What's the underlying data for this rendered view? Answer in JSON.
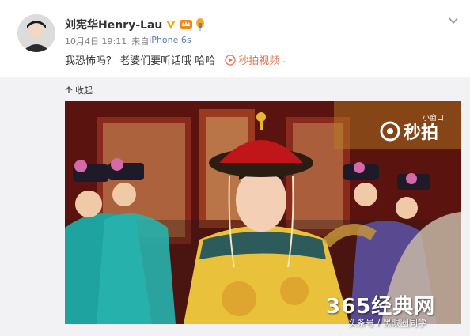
{
  "post": {
    "username": "刘宪华Henry-Lau",
    "time": "10月4日 19:11",
    "source_prefix": "来自",
    "device": "iPhone 6s",
    "text": "我恐怖吗？ 老婆们要听话哦 哈哈",
    "video_link": "秒拍视频",
    "trailing": "."
  },
  "actions": {
    "collapse": "收起"
  },
  "video": {
    "brand": "秒拍",
    "mini_window": "小窗口",
    "watermark_site": "365经典网",
    "watermark_wechat": "头条号 / 黑眼圈同学"
  },
  "colors": {
    "link": "#eb7350",
    "username": "#333333",
    "meta": "#808080",
    "verified": "#f7ab00",
    "panel": "#f2f2f5"
  },
  "icons": {
    "verified": "verified-badge-icon",
    "vip": "vip-crown-icon",
    "balloon": "balloon-icon",
    "chevron": "chevron-down-icon",
    "play": "play-link-icon",
    "collapse": "collapse-arrow-icon",
    "brand": "miaopai-logo-icon"
  }
}
